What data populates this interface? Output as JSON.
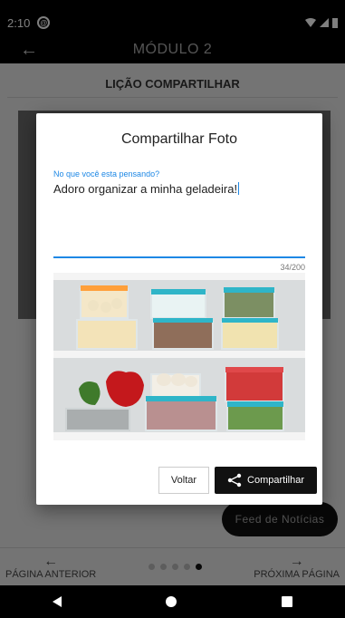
{
  "status_bar": {
    "time": "2:10"
  },
  "app_bar": {
    "title": "MÓDULO 2"
  },
  "lesson": {
    "title": "LIÇÃO COMPARTILHAR"
  },
  "dialog": {
    "title": "Compartilhar Foto",
    "input_label": "No que você esta pensando?",
    "input_value": "Adoro organizar a minha geladeira!",
    "char_counter": "34/200",
    "back_label": "Voltar",
    "share_label": "Compartilhar"
  },
  "feed_button": {
    "label": "Feed de Notícias"
  },
  "bottom_nav": {
    "prev_label": "PÁGINA ANTERIOR",
    "next_label": "PRÓXIMA PÁGINA",
    "page_count": 5,
    "active_page": 5
  },
  "colors": {
    "accent": "#1e88e5",
    "lid": "#2fb5c8",
    "primary_dark": "#111111"
  },
  "icons": [
    "back-arrow-icon",
    "wifi-icon",
    "signal-icon",
    "battery-icon",
    "share-icon",
    "arrow-left-icon",
    "arrow-right-icon",
    "nav-back-icon",
    "nav-home-icon",
    "nav-recents-icon"
  ]
}
